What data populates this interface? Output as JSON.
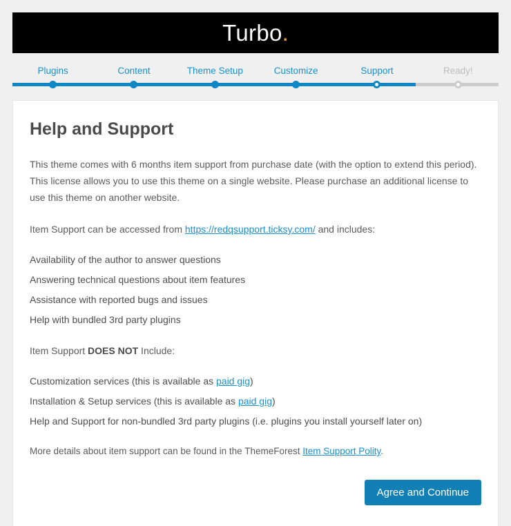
{
  "brand": {
    "name": "Turbo",
    "dot": ".",
    "dot_color": "#e8a33d",
    "bar_color": "#000000"
  },
  "theme": {
    "accent": "#0e87c4",
    "link": "#1a8fce",
    "button": "#1380b5",
    "inactive": "#cccccc",
    "page_background": "#f0f0f0"
  },
  "steps": [
    {
      "label": "Plugins",
      "state": "done"
    },
    {
      "label": "Content",
      "state": "done"
    },
    {
      "label": "Theme Setup",
      "state": "done"
    },
    {
      "label": "Customize",
      "state": "done"
    },
    {
      "label": "Support",
      "state": "current"
    },
    {
      "label": "Ready!",
      "state": "todo"
    }
  ],
  "progress_percent": 83,
  "main": {
    "title": "Help and Support",
    "intro": "This theme comes with 6 months item support from purchase date (with the option to extend this period). This license allows you to use this theme on a single website. Please purchase an additional license to use this theme on another website.",
    "access": {
      "before": "Item Support can be accessed from ",
      "link_text": "https://redqsupport.ticksy.com/",
      "after": " and includes:"
    },
    "includes": [
      "Availability of the author to answer questions",
      "Answering technical questions about item features",
      "Assistance with reported bugs and issues",
      "Help with bundled 3rd party plugins"
    ],
    "excludes_heading": {
      "before": "Item Support ",
      "strong": "DOES NOT",
      "after": " Include:"
    },
    "excludes": [
      {
        "before": "Customization services (this is available as ",
        "link_text": "paid gig",
        "after": ")"
      },
      {
        "before": "Installation & Setup services (this is available as ",
        "link_text": "paid gig",
        "after": ")"
      },
      {
        "before": "Help and Support for non-bundled 3rd party plugins (i.e. plugins you install yourself later on)",
        "link_text": "",
        "after": ""
      }
    ],
    "footnote": {
      "before": "More details about item support can be found in the ThemeForest ",
      "link_text": "Item Support Polity",
      "after": "."
    },
    "submit_label": "Agree and Continue"
  }
}
